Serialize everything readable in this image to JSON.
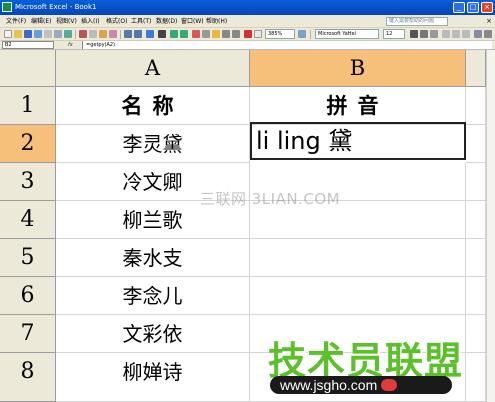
{
  "window": {
    "title": "Microsoft Excel - Book1",
    "min": "_",
    "max": "□",
    "close": "×"
  },
  "menu": {
    "items": [
      "文件(F)",
      "编辑(E)",
      "视图(V)",
      "插入(I)",
      "格式(O)",
      "工具(T)",
      "数据(D)",
      "窗口(W)",
      "帮助(H)"
    ],
    "help_placeholder": "键入需要帮助的问题",
    "close": "×"
  },
  "toolbar": {
    "zoom": "385%",
    "font": "Microsoft YaHei",
    "size": "12"
  },
  "formula_bar": {
    "name_box": "B2",
    "fx": "fx",
    "formula": "=getpy(A2)"
  },
  "grid": {
    "columns": [
      "A",
      "B"
    ],
    "selected_column": "B",
    "selected_row": "2",
    "rows": [
      {
        "num": "1",
        "a": "名称",
        "b": "拼音"
      },
      {
        "num": "2",
        "a": "李灵黛",
        "b": "li ling 黛"
      },
      {
        "num": "3",
        "a": "冷文卿",
        "b": ""
      },
      {
        "num": "4",
        "a": "柳兰歌",
        "b": ""
      },
      {
        "num": "5",
        "a": "秦水支",
        "b": ""
      },
      {
        "num": "6",
        "a": "李念儿",
        "b": ""
      },
      {
        "num": "7",
        "a": "文彩依",
        "b": ""
      },
      {
        "num": "8",
        "a": "柳婵诗",
        "b": ""
      }
    ]
  },
  "watermarks": {
    "site1": "三联网 3LIAN.COM",
    "site2": "技术员联盟",
    "site3": "www.jsgho.com"
  },
  "colors": {
    "selected_header": "#f6c07b",
    "watermark_green": "#5bc02a"
  }
}
